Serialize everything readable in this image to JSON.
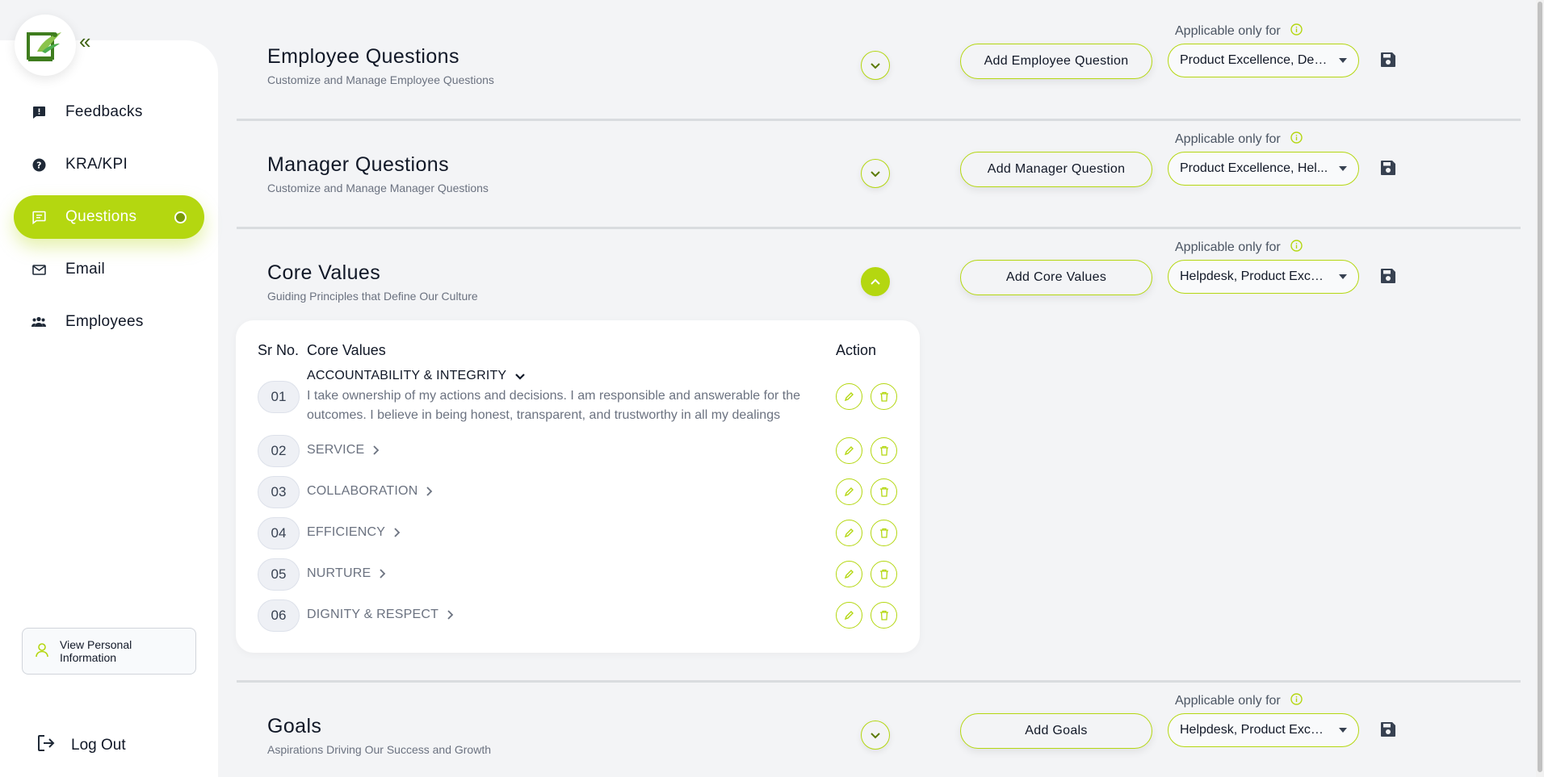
{
  "colors": {
    "accent": "#b4d710",
    "accent_dark": "#7a9a07",
    "text": "#111827",
    "muted": "#6b7280"
  },
  "sidebar": {
    "logo_icon": "company-logo",
    "collapse_icon": "double-chevron-left-icon",
    "items": [
      {
        "label": "Feedbacks",
        "icon": "feedback-icon",
        "active": false
      },
      {
        "label": "KRA/KPI",
        "icon": "help-circle-icon",
        "active": false
      },
      {
        "label": "Questions",
        "icon": "question-bubble-icon",
        "active": true
      },
      {
        "label": "Email",
        "icon": "mail-icon",
        "active": false
      },
      {
        "label": "Employees",
        "icon": "people-icon",
        "active": false
      }
    ],
    "view_info_label": "View Personal Information",
    "logout_label": "Log Out"
  },
  "sections": [
    {
      "title": "Employee Questions",
      "subtitle": "Customize and Manage Employee Questions",
      "expanded": false,
      "add_label": "Add Employee Question",
      "applicable_label": "Applicable only for",
      "selected": "Product Excellence, Dev..."
    },
    {
      "title": "Manager Questions",
      "subtitle": "Customize and Manage Manager Questions",
      "expanded": false,
      "add_label": "Add Manager Question",
      "applicable_label": "Applicable only for",
      "selected": "Product Excellence, Hel..."
    },
    {
      "title": "Core Values",
      "subtitle": "Guiding Principles that Define Our Culture",
      "expanded": true,
      "add_label": "Add Core Values",
      "applicable_label": "Applicable only for",
      "selected": "Helpdesk, Product Excel..."
    },
    {
      "title": "Goals",
      "subtitle": "Aspirations Driving Our Success and Growth",
      "expanded": false,
      "add_label": "Add Goals",
      "applicable_label": "Applicable only for",
      "selected": "Helpdesk, Product Excel..."
    }
  ],
  "core_values_table": {
    "headers": {
      "sr": "Sr No.",
      "name": "Core Values",
      "action": "Action"
    },
    "rows": [
      {
        "num": "01",
        "name": "ACCOUNTABILITY & INTEGRITY",
        "expanded": true,
        "description": "I take ownership of my actions and decisions. I am responsible and answerable for the outcomes. I believe in being honest, transparent, and trustworthy in all my dealings"
      },
      {
        "num": "02",
        "name": "SERVICE",
        "expanded": false
      },
      {
        "num": "03",
        "name": "COLLABORATION",
        "expanded": false
      },
      {
        "num": "04",
        "name": "EFFICIENCY",
        "expanded": false
      },
      {
        "num": "05",
        "name": "NURTURE",
        "expanded": false
      },
      {
        "num": "06",
        "name": "DIGNITY & RESPECT",
        "expanded": false
      }
    ]
  }
}
